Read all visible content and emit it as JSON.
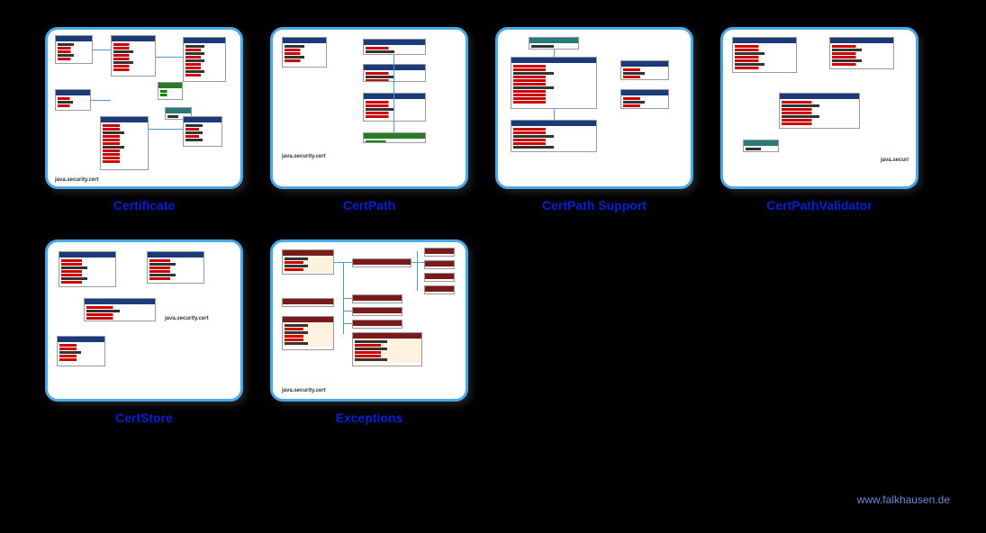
{
  "cards": [
    {
      "label": "Certificate",
      "package": "java.security.cert"
    },
    {
      "label": "CertPath",
      "package": "java.security.cert"
    },
    {
      "label": "CertPath Support",
      "package": ""
    },
    {
      "label": "CertPathValidator",
      "package": "java.securi"
    },
    {
      "label": "CertStore",
      "package": "java.security.cert"
    },
    {
      "label": "Exceptions",
      "package": "java.security.cert"
    }
  ],
  "footer": "www.falkhausen.de"
}
